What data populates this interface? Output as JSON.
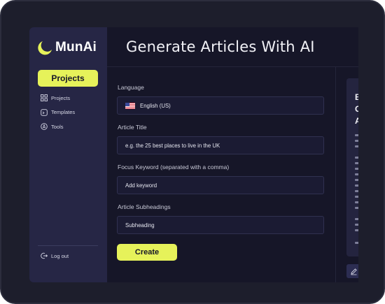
{
  "app": {
    "logo_text": "MunAi",
    "accent_color": "#e6f25a",
    "logo_icon": "crescent-moon-icon"
  },
  "sidebar": {
    "primary_button_label": "Projects",
    "items": [
      {
        "label": "Projects",
        "icon": "grid-icon"
      },
      {
        "label": "Templates",
        "icon": "template-icon"
      },
      {
        "label": "Tools",
        "icon": "compass-icon"
      }
    ],
    "logout_label": "Log out",
    "logout_icon": "logout-icon"
  },
  "header": {
    "title": "Generate Articles With AI"
  },
  "form": {
    "language": {
      "label": "Language",
      "value": "English (US)",
      "icon": "us-flag-icon"
    },
    "article_title": {
      "label": "Article Title",
      "placeholder": "e.g. the 25 best places to live in the UK"
    },
    "focus_keyword": {
      "label": "Focus Keyword (separated with a comma)",
      "placeholder": "Add keyword"
    },
    "subheadings": {
      "label": "Article Subheadings",
      "value": "Subheading"
    },
    "submit_label": "Create"
  },
  "right_panel": {
    "heading_letters": [
      "B",
      "C",
      "A"
    ],
    "body_letters": [
      "A",
      "a",
      "t",
      "T",
      "l",
      "a",
      "b",
      "li",
      "a",
      "A",
      "t",
      "A",
      "a",
      "t",
      "A"
    ],
    "edit_icon": "pencil-icon"
  }
}
